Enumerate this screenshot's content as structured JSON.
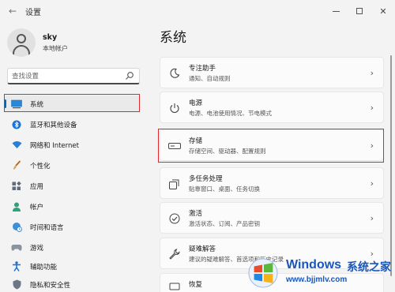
{
  "window": {
    "title": "设置",
    "back_icon": "arrow-left-icon",
    "controls": [
      "minimize-icon",
      "maximize-icon",
      "close-icon"
    ]
  },
  "user": {
    "name": "sky",
    "account_type": "本地帐户"
  },
  "search": {
    "placeholder": "查找设置"
  },
  "sidebar": {
    "items": [
      {
        "label": "系统",
        "icon": "display-icon",
        "active": true
      },
      {
        "label": "蓝牙和其他设备",
        "icon": "bluetooth-icon"
      },
      {
        "label": "网络和 Internet",
        "icon": "wifi-icon"
      },
      {
        "label": "个性化",
        "icon": "brush-icon"
      },
      {
        "label": "应用",
        "icon": "apps-icon"
      },
      {
        "label": "帐户",
        "icon": "person-icon"
      },
      {
        "label": "时间和语言",
        "icon": "globe-clock-icon"
      },
      {
        "label": "游戏",
        "icon": "gamepad-icon"
      },
      {
        "label": "辅助功能",
        "icon": "accessibility-icon"
      },
      {
        "label": "隐私和安全性",
        "icon": "shield-icon"
      }
    ]
  },
  "main": {
    "title": "系统",
    "cards": [
      {
        "title": "专注助手",
        "subtitle": "通知、自动规则",
        "icon": "focus-moon-icon"
      },
      {
        "title": "电源",
        "subtitle": "电源、电池使用情况、节电模式",
        "icon": "power-icon"
      },
      {
        "title": "存储",
        "subtitle": "存储空间、驱动器、配置规则",
        "icon": "storage-icon"
      },
      {
        "title": "多任务处理",
        "subtitle": "贴靠窗口、桌面、任务切换",
        "icon": "multitask-icon"
      },
      {
        "title": "激活",
        "subtitle": "激活状态、订阅、产品密钥",
        "icon": "activation-check-icon"
      },
      {
        "title": "疑难解答",
        "subtitle": "建议的疑难解答、首选项和历史记录",
        "icon": "wrench-icon"
      },
      {
        "title": "恢复",
        "subtitle": "",
        "icon": "recovery-icon"
      }
    ]
  },
  "watermark": {
    "brand": "Windows",
    "suffix": "系统之家",
    "url": "www.bjjmlv.com"
  },
  "colors": {
    "accent": "#0067c0",
    "highlight_border": "#e0282e",
    "background": "#f3f3f3",
    "card_background": "#fbfbfb"
  }
}
